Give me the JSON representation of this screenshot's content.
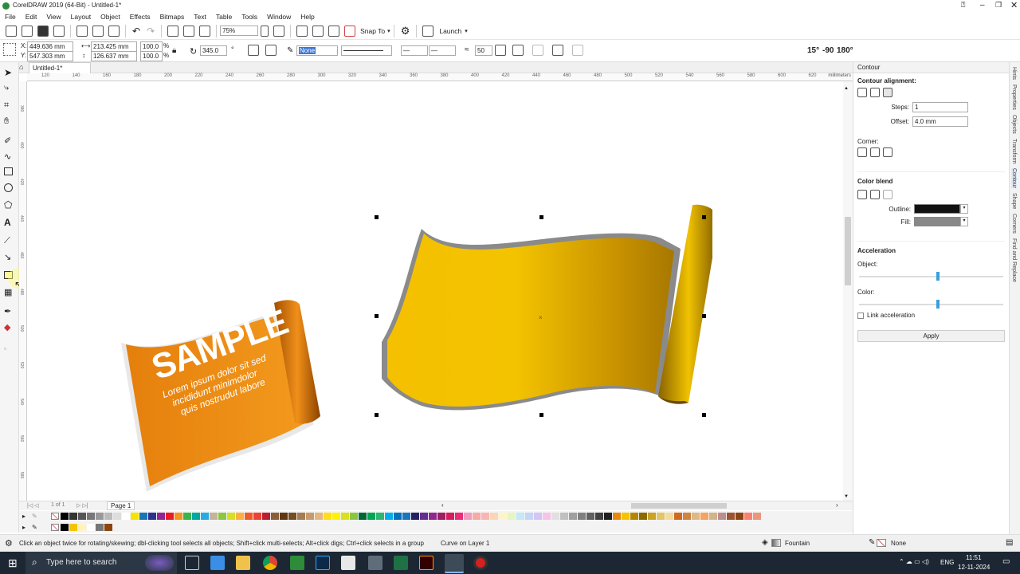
{
  "window": {
    "title": "CorelDRAW 2019 (64-Bit) - Untitled-1*"
  },
  "menu": [
    "File",
    "Edit",
    "View",
    "Layout",
    "Object",
    "Effects",
    "Bitmaps",
    "Text",
    "Table",
    "Tools",
    "Window",
    "Help"
  ],
  "toolbar": {
    "zoom": "75%",
    "snap_label": "Snap To",
    "launch_label": "Launch"
  },
  "property_bar": {
    "x": "449.636 mm",
    "y": "547.303 mm",
    "width": "213.425 mm",
    "height": "126.637 mm",
    "scale_w": "100.0",
    "scale_h": "100.0",
    "pct": "%",
    "rotation": "345.0",
    "deg": "°",
    "outline": "None",
    "contour_steps": "50",
    "angles": [
      "15°",
      "-90",
      "180°"
    ]
  },
  "doc_tab": "Untitled-1*",
  "ruler_units": "millimeters",
  "ruler_ticks": [
    "120",
    "140",
    "160",
    "180",
    "200",
    "220",
    "240",
    "260",
    "280",
    "300",
    "320",
    "340",
    "360",
    "380",
    "400",
    "420",
    "440",
    "460",
    "480",
    "500",
    "520",
    "540",
    "560",
    "580",
    "600",
    "620"
  ],
  "v_ruler_ticks": [
    "380",
    "400",
    "420",
    "440",
    "460",
    "480",
    "500",
    "520",
    "540",
    "560",
    "580"
  ],
  "artwork": {
    "headline": "SAMPLE",
    "body": [
      "Lorem ipsum dolor sit sed",
      "incididunt minimdolor",
      "quis nostrudut labore"
    ]
  },
  "page_nav": {
    "pages": "1 of 1",
    "page_tab": "Page 1"
  },
  "contour_panel": {
    "title": "Contour",
    "alignment_label": "Contour alignment:",
    "steps_label": "Steps:",
    "steps_value": "1",
    "offset_label": "Offset:",
    "offset_value": "4.0 mm",
    "corner_label": "Corner:",
    "color_blend_label": "Color blend",
    "outline_label": "Outline:",
    "fill_label": "Fill:",
    "acceleration_label": "Acceleration",
    "object_label": "Object:",
    "color_label": "Color:",
    "object_accel": 0.55,
    "color_accel": 0.55,
    "link_label": "Link acceleration",
    "apply_label": "Apply"
  },
  "side_tabs": [
    "Hints",
    "Properties",
    "Objects",
    "Transform",
    "Contour",
    "Shape",
    "Corners",
    "Find and Replace"
  ],
  "status": {
    "hint": "Click an object twice for rotating/skewing; dbl-clicking tool selects all objects; Shift+click multi-selects; Alt+click digs; Ctrl+click selects in a group",
    "selection": "Curve on Layer 1",
    "fill": "Fountain",
    "outline": "None"
  },
  "taskbar": {
    "search_placeholder": "Type here to search",
    "lang": "ENG",
    "time": "11:51",
    "date": "12-11-2024"
  },
  "colors": {
    "orange": "#e8890f",
    "gold": "#f5c400",
    "dark_gold": "#b58600",
    "accent": "#3b9fdc"
  },
  "palette": [
    "#000000",
    "#333333",
    "#555555",
    "#777777",
    "#999999",
    "#bbbbbb",
    "#dddddd",
    "#ffffff",
    "#f5e400",
    "#1b75bc",
    "#2e3192",
    "#92278f",
    "#ed1c24",
    "#f7941d",
    "#39b54a",
    "#00a99d",
    "#29abe2",
    "#c2b59b",
    "#8dc63f",
    "#d7df23",
    "#fbb040",
    "#f15a29",
    "#ef4136",
    "#be1e2d",
    "#8b5e3c",
    "#603913",
    "#754c24",
    "#a67c52",
    "#c69c6d",
    "#e6b77b",
    "#ffde17",
    "#fff200",
    "#d9e021",
    "#8cc63f",
    "#006838",
    "#00a651",
    "#2bb673",
    "#00aeef",
    "#0072bc",
    "#1c75bc",
    "#262262",
    "#662d91",
    "#92278f",
    "#9e1f63",
    "#da1c5c",
    "#ee2a7b",
    "#f49ac1",
    "#f7a9a8",
    "#fbb4b4",
    "#fcd5b4",
    "#fff5c4",
    "#e6f5c4",
    "#c4e8f5",
    "#c4d5f5",
    "#d5c4f5",
    "#f5c4e6",
    "#e0e0e0",
    "#c0c0c0",
    "#a0a0a0",
    "#808080",
    "#606060",
    "#404040",
    "#202020",
    "#e8890f",
    "#f5c400",
    "#b58600",
    "#8a6b00",
    "#c9a227",
    "#e3c565",
    "#f0dca0",
    "#d2691e",
    "#cd853f",
    "#deb887",
    "#f4a460",
    "#d2b48c",
    "#bc8f8f",
    "#a0522d",
    "#8b4513",
    "#fa8072",
    "#e9967a"
  ],
  "palette2": [
    "#000000",
    "#f5c400",
    "#fff3c0",
    "#ffffff",
    "#777777",
    "#8b4513"
  ]
}
